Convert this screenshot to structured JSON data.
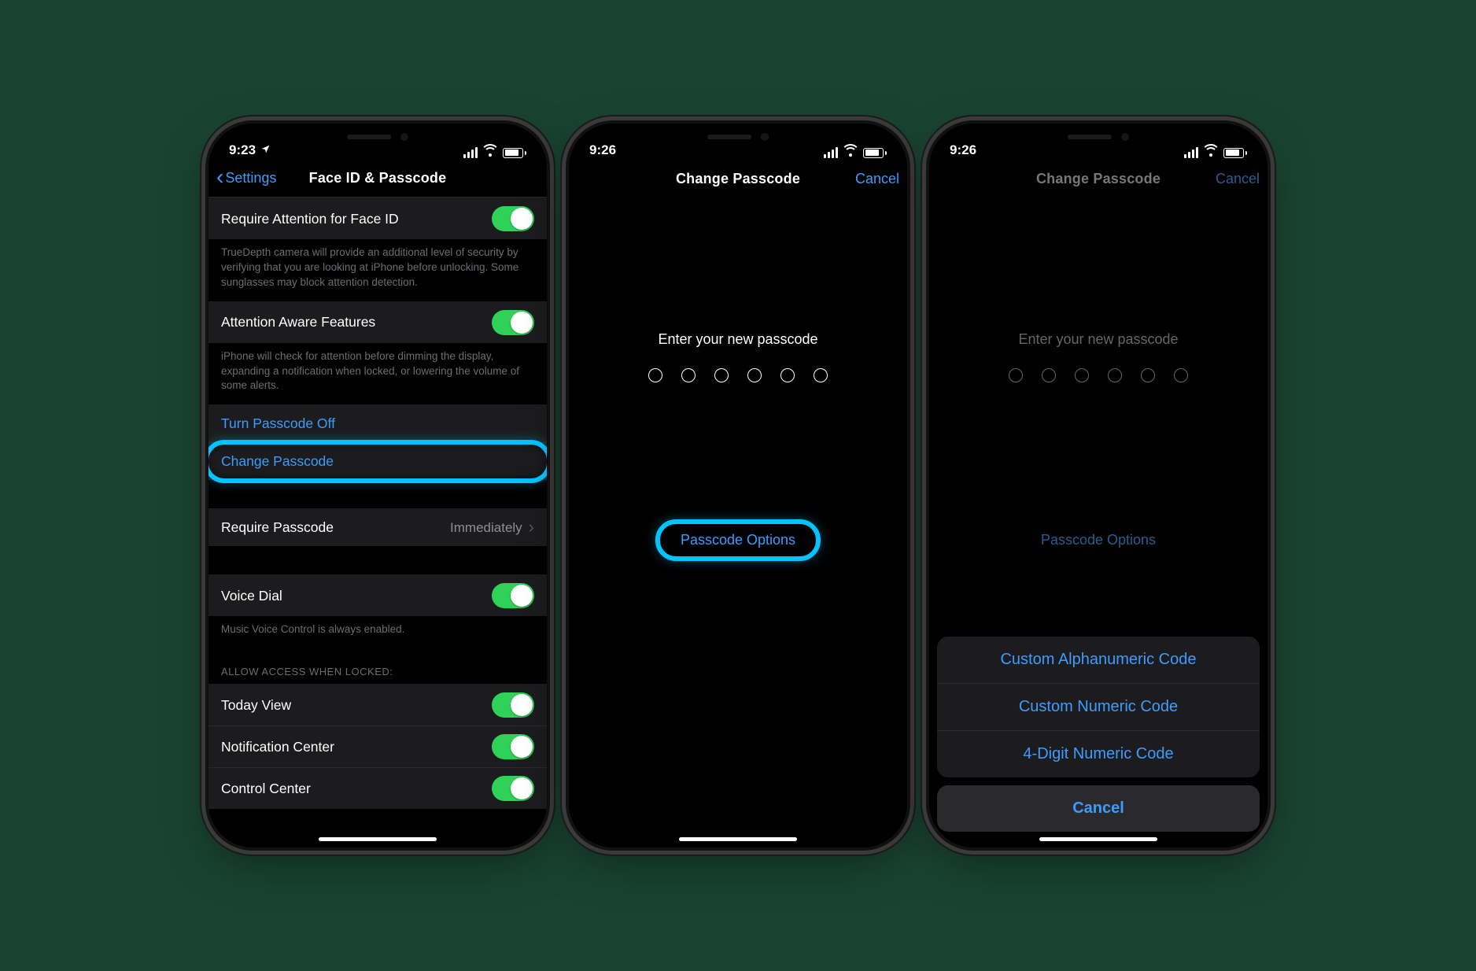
{
  "status": {
    "t1": "9:23",
    "t2": "9:26",
    "t3": "9:26"
  },
  "s1": {
    "back": "Settings",
    "title": "Face ID & Passcode",
    "rows": {
      "req_attn": "Require Attention for Face ID",
      "req_attn_footer": "TrueDepth camera will provide an additional level of security by verifying that you are looking at iPhone before unlocking. Some sunglasses may block attention detection.",
      "attn_aware": "Attention Aware Features",
      "attn_aware_footer": "iPhone will check for attention before dimming the display, expanding a notification when locked, or lowering the volume of some alerts.",
      "turn_off": "Turn Passcode Off",
      "change": "Change Passcode",
      "require": "Require Passcode",
      "require_val": "Immediately",
      "voice": "Voice Dial",
      "voice_footer": "Music Voice Control is always enabled.",
      "allow_hdr": "ALLOW ACCESS WHEN LOCKED:",
      "today": "Today View",
      "notif": "Notification Center",
      "cc": "Control Center"
    }
  },
  "s2": {
    "title": "Change Passcode",
    "cancel": "Cancel",
    "prompt": "Enter your new passcode",
    "options": "Passcode Options"
  },
  "s3": {
    "title": "Change Passcode",
    "cancel": "Cancel",
    "prompt": "Enter your new passcode",
    "options": "Passcode Options",
    "sheet": {
      "alpha": "Custom Alphanumeric Code",
      "numeric": "Custom Numeric Code",
      "four": "4-Digit Numeric Code",
      "cancel": "Cancel"
    }
  }
}
